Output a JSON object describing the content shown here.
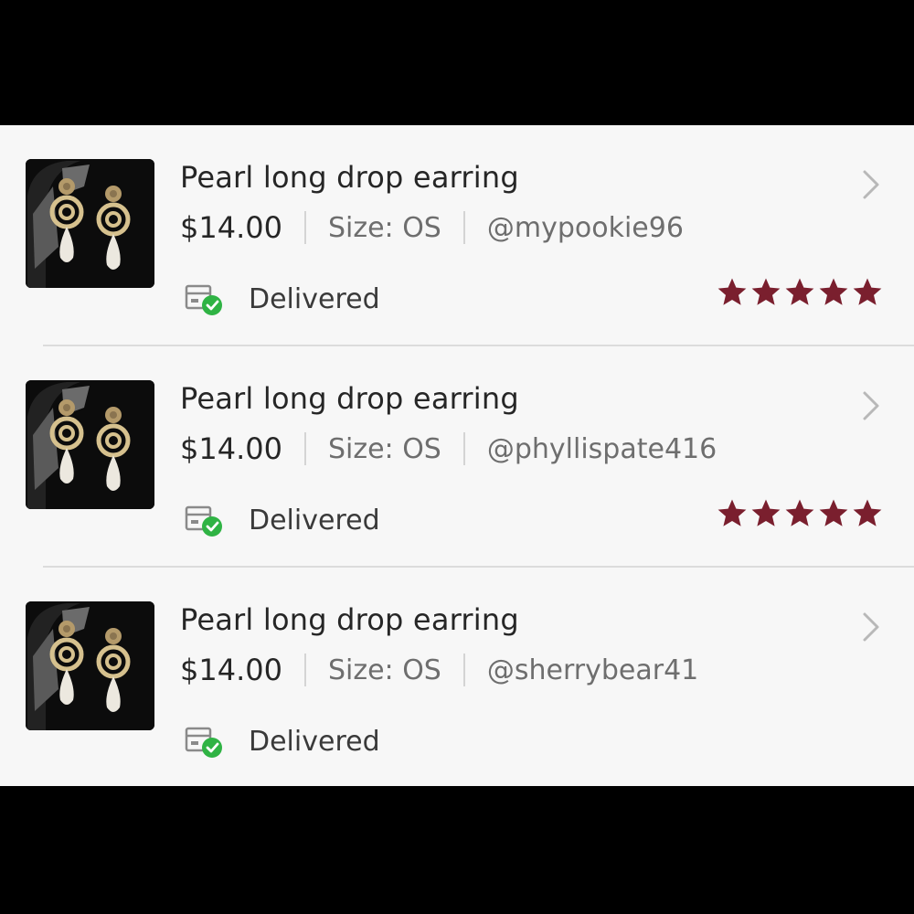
{
  "colors": {
    "star": "#7a1f2e",
    "delivered_check": "#2fb344",
    "background": "#f7f7f7",
    "frame": "#000000"
  },
  "orders": [
    {
      "title": "Pearl long drop earring",
      "price": "$14.00",
      "size": "Size: OS",
      "buyer": "@mypookie96",
      "status": "Delivered",
      "rating": 5,
      "icons": [
        "earring-thumbnail",
        "chevron-right-icon",
        "package-delivered-icon",
        "star-icon"
      ]
    },
    {
      "title": "Pearl long drop earring",
      "price": "$14.00",
      "size": "Size: OS",
      "buyer": "@phyllispate416",
      "status": "Delivered",
      "rating": 5,
      "icons": [
        "earring-thumbnail",
        "chevron-right-icon",
        "package-delivered-icon",
        "star-icon"
      ]
    },
    {
      "title": "Pearl long drop earring",
      "price": "$14.00",
      "size": "Size: OS",
      "buyer": "@sherrybear41",
      "status": "Delivered",
      "rating": 0,
      "icons": [
        "earring-thumbnail",
        "chevron-right-icon",
        "package-delivered-icon"
      ]
    }
  ]
}
